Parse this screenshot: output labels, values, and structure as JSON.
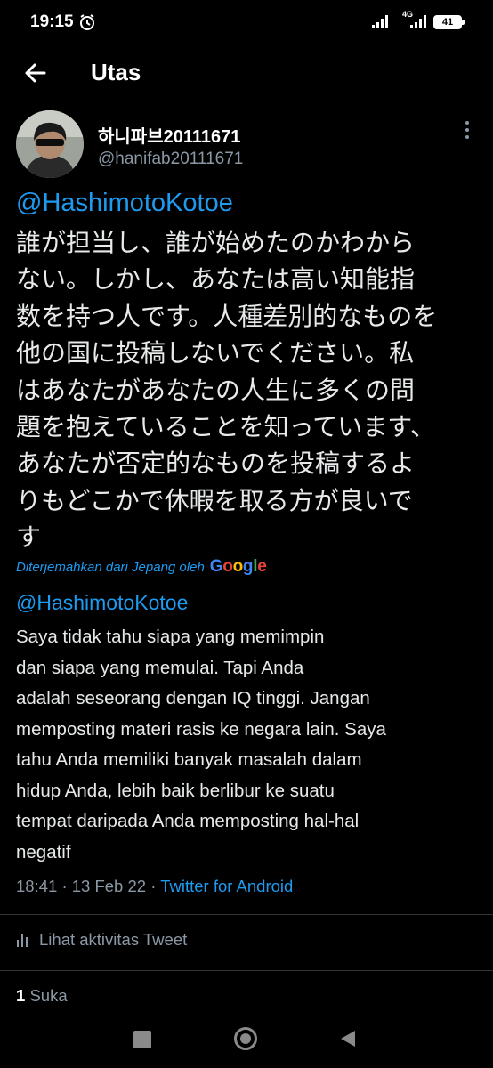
{
  "status_bar": {
    "time": "19:15",
    "network": "4G",
    "battery": "41"
  },
  "header": {
    "title": "Utas"
  },
  "tweet": {
    "display_name": "하니파브20111671",
    "handle": "@hanifab20111671",
    "mention": "@HashimotoKotoe",
    "body_japanese": "誰が担当し、誰が始めたのかわから\nない。しかし、あなたは高い知能指\n数を持つ人です。人種差別的なものを\n他の国に投稿しないでください。私\nはあなたがあなたの人生に多くの問\n題を抱えていることを知っています、\nあなたが否定的なものを投稿するよ\nりもどこかで休暇を取る方が良いで\nす",
    "translated_label": "Diterjemahkan dari Jepang oleh",
    "translator": "Google",
    "translated_mention": "@HashimotoKotoe",
    "translated_text": " Saya tidak tahu siapa yang memimpin\ndan siapa yang memulai. Tapi Anda\nadalah seseorang dengan IQ tinggi. Jangan\nmemposting materi rasis ke negara lain. Saya\ntahu Anda memiliki banyak masalah dalam\nhidup Anda, lebih baik berlibur ke suatu\ntempat daripada Anda memposting hal-hal\nnegatif",
    "time": "18:41",
    "separator": "·",
    "date": "13 Feb 22",
    "source": "Twitter for Android",
    "activity_label": "Lihat aktivitas Tweet",
    "likes_count": "1",
    "likes_label": "Suka"
  },
  "colors": {
    "background": "#000000",
    "accent": "#1d9bf0",
    "secondary_text": "#8b98a5",
    "primary_text": "#e7e9ea"
  }
}
